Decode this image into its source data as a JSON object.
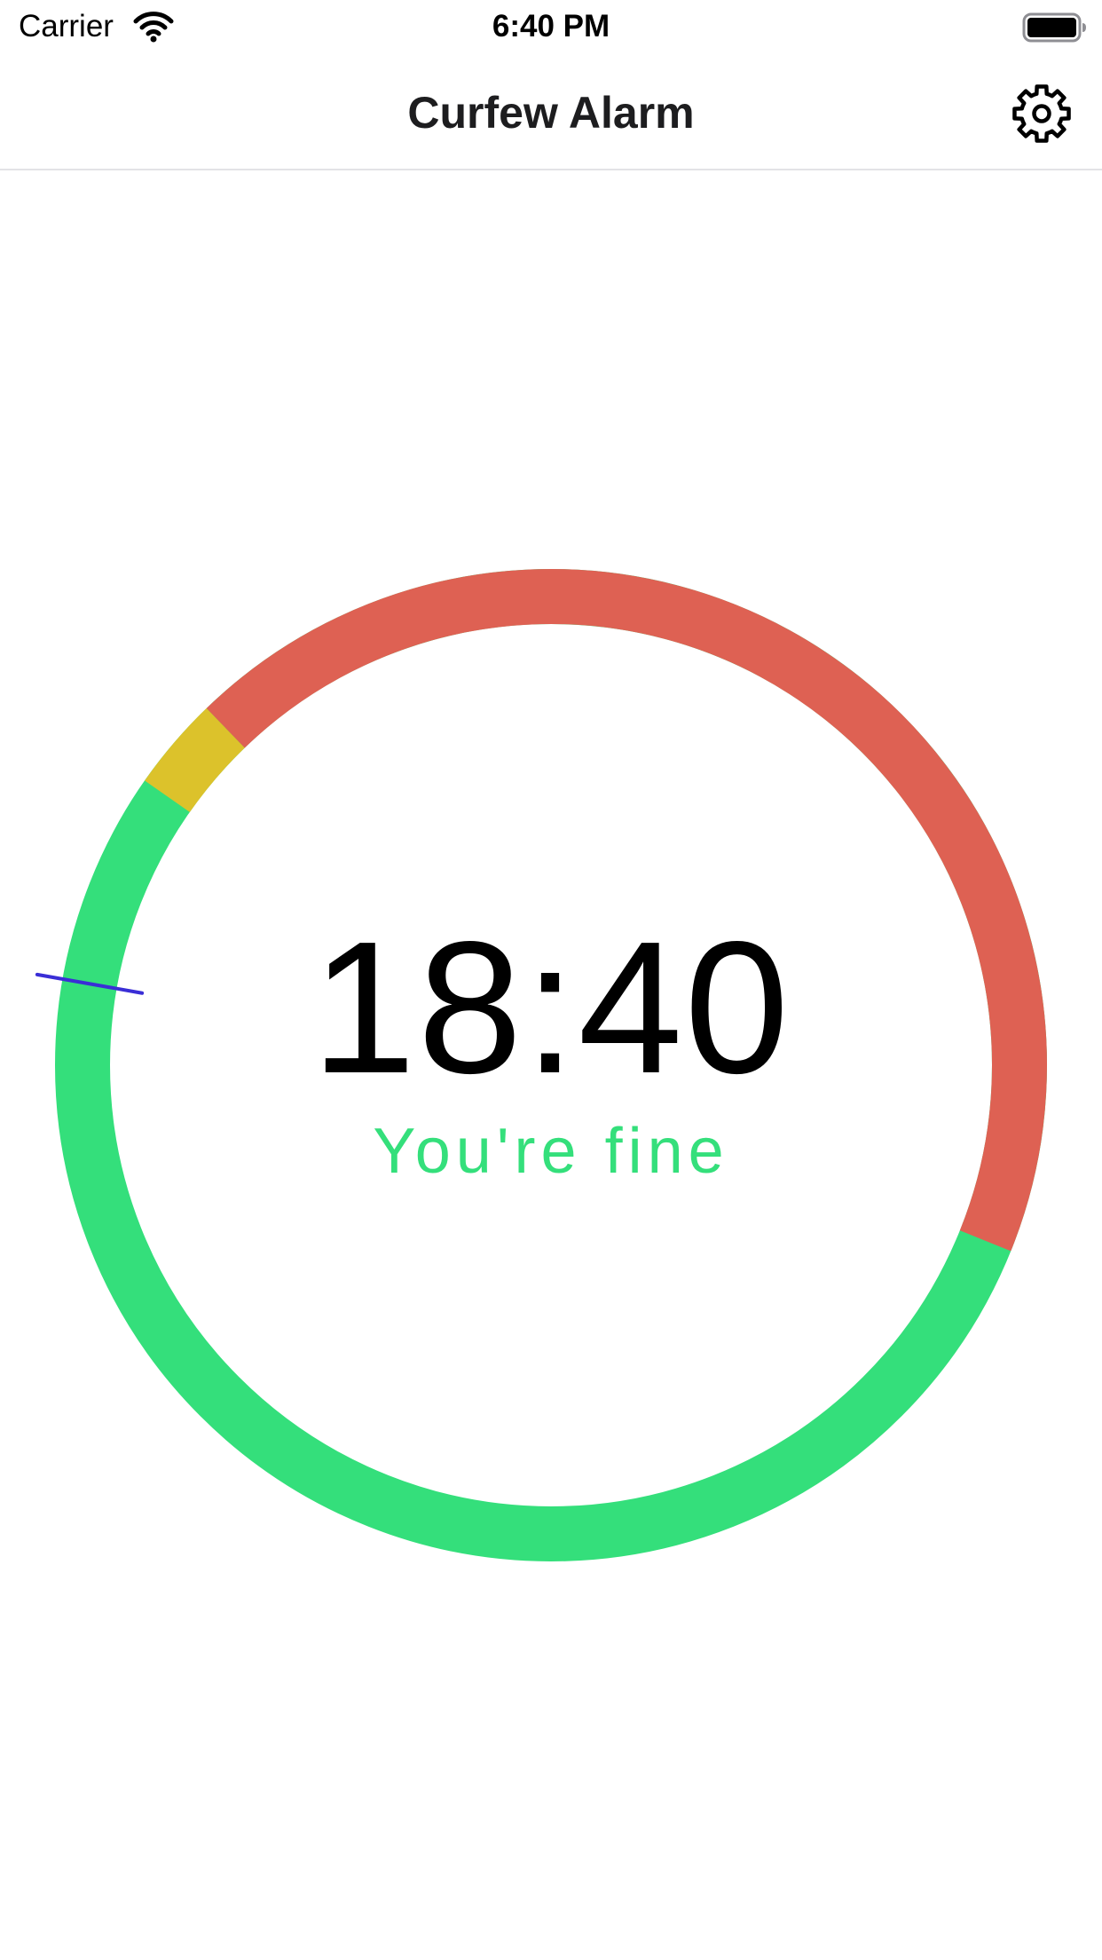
{
  "status_bar": {
    "carrier": "Carrier",
    "time": "6:40 PM",
    "icons": [
      "wifi-icon",
      "battery-icon"
    ]
  },
  "nav": {
    "title": "Curfew Alarm",
    "settings_icon": "gear-icon"
  },
  "clock": {
    "time": "18:40",
    "message": "You're fine",
    "message_color": "#34df7b",
    "segments": [
      {
        "state": "ok",
        "color": "#34df7b",
        "start_deg": 112,
        "end_deg": 324
      },
      {
        "state": "warning",
        "color": "#dcc22b",
        "start_deg": 324,
        "end_deg": 316
      },
      {
        "state": "curfew",
        "color": "#de6153",
        "start_deg": 316,
        "end_deg": 112
      }
    ],
    "indicator": {
      "color": "#3a2ed6",
      "angle_deg": 280
    }
  }
}
